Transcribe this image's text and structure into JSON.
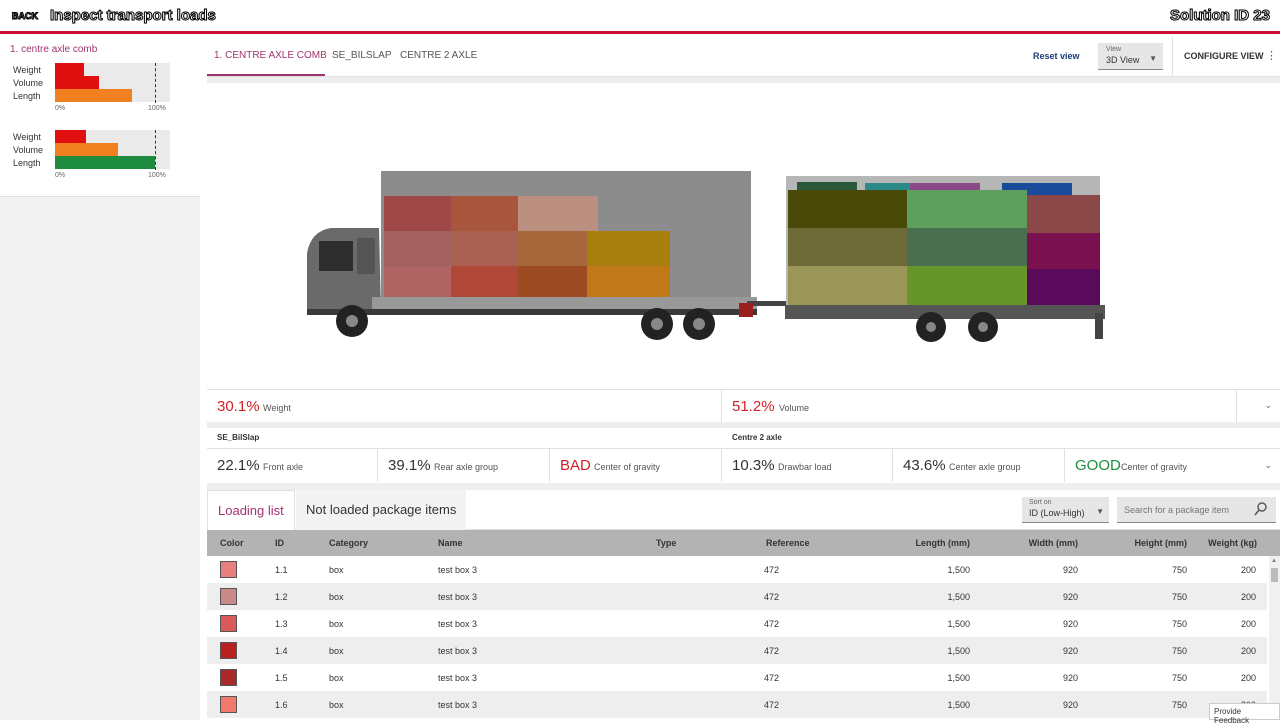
{
  "topbar": {
    "back": "BACK",
    "title": "Inspect transport loads",
    "solution": "Solution ID 23"
  },
  "sidebar": {
    "card_title": "1. centre axle comb",
    "blocks": [
      {
        "bars": [
          {
            "label": "Weight",
            "value": 0.25,
            "color": "#e01010"
          },
          {
            "label": "Volume",
            "value": 0.38,
            "color": "#e01010"
          },
          {
            "label": "Length",
            "value": 0.67,
            "color": "#f08020"
          }
        ],
        "scale_min": "0%",
        "scale_max": "100%"
      },
      {
        "bars": [
          {
            "label": "Weight",
            "value": 0.27,
            "color": "#e01010"
          },
          {
            "label": "Volume",
            "value": 0.55,
            "color": "#f08020"
          },
          {
            "label": "Length",
            "value": 0.87,
            "color": "#1e8c40"
          }
        ],
        "scale_min": "0%",
        "scale_max": "100%"
      }
    ]
  },
  "tabs": [
    "1. CENTRE AXLE COMB",
    "SE_BILSLAP",
    "CENTRE 2 AXLE"
  ],
  "toolbar": {
    "reset": "Reset view",
    "view_label": "View",
    "view_value": "3D View",
    "configure": "CONFIGURE VIEW"
  },
  "stats1": [
    {
      "value": "30.1%",
      "label": "Weight",
      "status": "red"
    },
    {
      "value": "51.2%",
      "label": "Volume",
      "status": "red"
    }
  ],
  "groups": [
    "SE_BilSlap",
    "Centre 2 axle"
  ],
  "stats2": [
    {
      "value": "22.1%",
      "label": "Front axle",
      "status": "normal"
    },
    {
      "value": "39.1%",
      "label": "Rear axle group",
      "status": "normal"
    },
    {
      "value": "BAD",
      "label": "Center of gravity",
      "status": "red"
    },
    {
      "value": "10.3%",
      "label": "Drawbar load",
      "status": "normal"
    },
    {
      "value": "43.6%",
      "label": "Center axle group",
      "status": "normal"
    },
    {
      "value": "GOOD",
      "label": "Center of gravity",
      "status": "green"
    }
  ],
  "list_tabs": [
    "Loading list",
    "Not loaded package items"
  ],
  "sort": {
    "label": "Sort on",
    "value": "ID (Low-High)"
  },
  "search": {
    "placeholder": "Search for a package item"
  },
  "table": {
    "headers": [
      "Color",
      "ID",
      "Category",
      "Name",
      "Type",
      "Reference",
      "Length (mm)",
      "Width (mm)",
      "Height (mm)",
      "Weight (kg)"
    ],
    "rows": [
      {
        "color": "#e97e7e",
        "id": "1.1",
        "category": "box",
        "name": "test box 3",
        "type": "",
        "reference": "472",
        "length": "1,500",
        "width": "920",
        "height": "750",
        "weight": "200"
      },
      {
        "color": "#c98a8a",
        "id": "1.2",
        "category": "box",
        "name": "test box 3",
        "type": "",
        "reference": "472",
        "length": "1,500",
        "width": "920",
        "height": "750",
        "weight": "200"
      },
      {
        "color": "#d95a5a",
        "id": "1.3",
        "category": "box",
        "name": "test box 3",
        "type": "",
        "reference": "472",
        "length": "1,500",
        "width": "920",
        "height": "750",
        "weight": "200"
      },
      {
        "color": "#b82020",
        "id": "1.4",
        "category": "box",
        "name": "test box 3",
        "type": "",
        "reference": "472",
        "length": "1,500",
        "width": "920",
        "height": "750",
        "weight": "200"
      },
      {
        "color": "#a82a2a",
        "id": "1.5",
        "category": "box",
        "name": "test box 3",
        "type": "",
        "reference": "472",
        "length": "1,500",
        "width": "920",
        "height": "750",
        "weight": "200"
      },
      {
        "color": "#f07a6e",
        "id": "1.6",
        "category": "box",
        "name": "test box 3",
        "type": "",
        "reference": "472",
        "length": "1,500",
        "width": "920",
        "height": "750",
        "weight": "200"
      }
    ]
  },
  "feedback": "Provide Feedback",
  "colors": {
    "accent": "#a0346e",
    "brand": "#c8102e",
    "bad": "#d31f26",
    "good": "#1c8c3c"
  }
}
